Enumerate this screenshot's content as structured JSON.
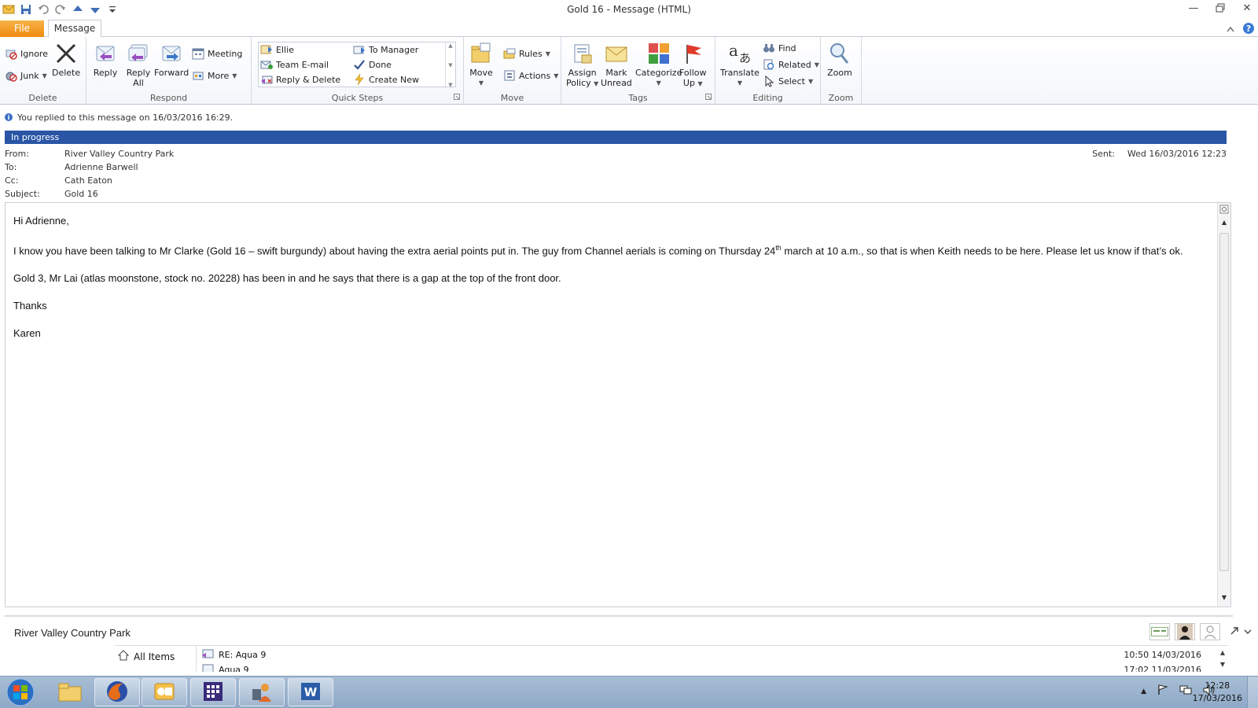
{
  "window": {
    "title": "Gold 16  -  Message (HTML)"
  },
  "tabs": {
    "file": "File",
    "message": "Message"
  },
  "ribbon": {
    "delete": {
      "label": "Delete",
      "ignore": "Ignore",
      "junk": "Junk",
      "delete": "Delete"
    },
    "respond": {
      "label": "Respond",
      "reply": "Reply",
      "reply_all_1": "Reply",
      "reply_all_2": "All",
      "forward": "Forward",
      "meeting": "Meeting",
      "more": "More"
    },
    "quick_steps": {
      "label": "Quick Steps",
      "items": [
        "Ellie",
        "Team E-mail",
        "Reply & Delete",
        "To Manager",
        "Done",
        "Create New"
      ]
    },
    "move": {
      "label": "Move",
      "move": "Move",
      "rules": "Rules",
      "actions": "Actions"
    },
    "tags": {
      "label": "Tags",
      "assign_policy_1": "Assign",
      "assign_policy_2": "Policy",
      "mark_unread_1": "Mark",
      "mark_unread_2": "Unread",
      "categorize": "Categorize",
      "follow_up_1": "Follow",
      "follow_up_2": "Up"
    },
    "editing": {
      "label": "Editing",
      "translate": "Translate",
      "find": "Find",
      "related": "Related",
      "select": "Select"
    },
    "zoom": {
      "label": "Zoom",
      "zoom": "Zoom"
    }
  },
  "info": {
    "replied": "You replied to this message on 16/03/2016 16:29.",
    "flag": "In progress"
  },
  "header": {
    "from_label": "From:",
    "from": "River Valley Country Park",
    "to_label": "To:",
    "to": "Adrienne Barwell",
    "cc_label": "Cc:",
    "cc": "Cath Eaton",
    "subject_label": "Subject:",
    "subject": "Gold 16",
    "sent_label": "Sent:",
    "sent": "Wed 16/03/2016 12:23"
  },
  "body": {
    "greeting": "Hi Adrienne,",
    "p1_a": "I know you have been talking to Mr Clarke (Gold 16 – swift burgundy) about having the extra aerial points put in.  The guy from Channel aerials is coming on Thursday 24",
    "p1_sup": "th",
    "p1_b": " march at 10 a.m., so that is when Keith needs to be here.  Please let us know if that’s ok.",
    "p2": "Gold 3, Mr Lai (atlas moonstone, stock no. 20228) has been in and he says that there is a gap at the top of the front door.",
    "thanks": "Thanks",
    "signature": "Karen"
  },
  "people_pane": {
    "name": "River Valley Country Park",
    "all_items": "All Items",
    "items": [
      {
        "subject": "RE: Aqua 9",
        "date": "10:50  14/03/2016"
      },
      {
        "subject": "Aqua 9",
        "date": "17:02  11/03/2016"
      }
    ]
  },
  "taskbar": {
    "time": "12:28",
    "date": "17/03/2016"
  },
  "colors": {
    "accent": "#2a55a5",
    "file_tab": "#ef8a0f"
  }
}
